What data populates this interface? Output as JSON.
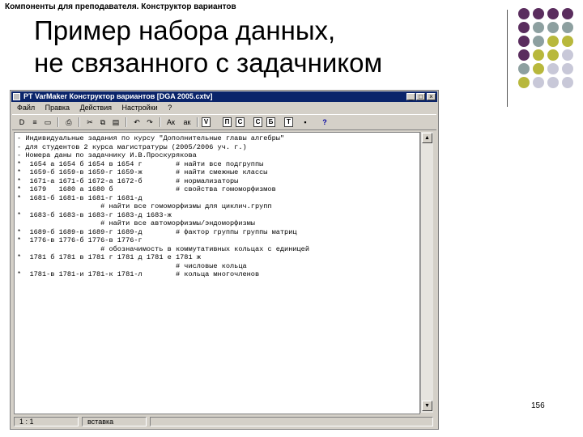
{
  "slide": {
    "header": "Компоненты для преподавателя. Конструктор вариантов",
    "title_line1": "Пример набора данных,",
    "title_line2": "не связанного с задачником",
    "page_number": "156",
    "dot_colors": [
      "#5a2d5e",
      "#8da0a0",
      "#b8b83c",
      "#c8c8d8"
    ]
  },
  "window": {
    "title": "PT VarMaker  Конструктор вариантов [DGA 2005.cxtv]",
    "controls": [
      "_",
      "□",
      "×"
    ],
    "menu": [
      "Файл",
      "Правка",
      "Действия",
      "Настройки",
      "?"
    ],
    "toolbar": [
      "D",
      "≡",
      "▭",
      "⎙",
      "✂",
      "⧉",
      "▤",
      "↶",
      "↷",
      "Ак",
      "ак",
      "V",
      "П",
      "С",
      "С",
      "Б",
      "Т",
      "▪",
      "?"
    ],
    "lines": [
      "- Индивидуальные задания по курсу \"Дополнительные главы алгебры\"",
      "- для студентов 2 курса магистратуры (2005/2006 уч. г.)",
      "- Номера даны по задачнику И.В.Проскурякова",
      "*  1654 а 1654 б 1654 в 1654 г        # найти все подгруппы",
      "*  1659-б 1659-в 1659-г 1659-ж        # найти смежные классы",
      "*  1671-а 1671-б 1672-а 1672-б        # нормализаторы",
      "*  1679   1680 а 1680 б               # свойства гомоморфизмов",
      "*  1681-б 1681-в 1681-г 1681-д",
      "                    # найти все гомоморфизмы для циклич.групп",
      "*  1683-б 1683-в 1683-г 1683-д 1683-ж",
      "                    # найти все автоморфизмы/эндоморфизмы",
      "*  1689-б 1689-в 1689-г 1689-д        # фактор группы группы матриц",
      "*  1776-в 1776-б 1776-в 1776-г",
      "                    # обозначимость в коммутативных кольцах с единицей",
      "*  1781 б 1781 в 1781 г 1781 д 1781 е 1781 ж",
      "                                      # числовые кольца",
      "*  1781-в 1781-и 1781-к 1781-л        # кольца многочленов"
    ],
    "status": [
      "1 : 1",
      "вставка"
    ]
  }
}
